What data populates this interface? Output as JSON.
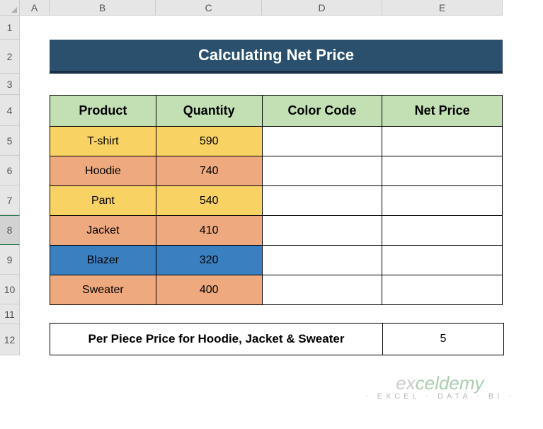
{
  "columns": [
    "A",
    "B",
    "C",
    "D",
    "E"
  ],
  "rows": [
    "1",
    "2",
    "3",
    "4",
    "5",
    "6",
    "7",
    "8",
    "9",
    "10",
    "11",
    "12"
  ],
  "title": "Calculating Net Price",
  "headers": {
    "product": "Product",
    "quantity": "Quantity",
    "color_code": "Color Code",
    "net_price": "Net Price"
  },
  "data": [
    {
      "product": "T-shirt",
      "quantity": "590",
      "color": "yellow"
    },
    {
      "product": "Hoodie",
      "quantity": "740",
      "color": "orange"
    },
    {
      "product": "Pant",
      "quantity": "540",
      "color": "yellow"
    },
    {
      "product": "Jacket",
      "quantity": "410",
      "color": "orange"
    },
    {
      "product": "Blazer",
      "quantity": "320",
      "color": "blue"
    },
    {
      "product": "Sweater",
      "quantity": "400",
      "color": "orange"
    }
  ],
  "footer": {
    "label": "Per Piece Price for Hoodie, Jacket & Sweater",
    "value": "5"
  },
  "selected_row": "8",
  "watermark": {
    "main_1": "ex",
    "main_2": "celdemy",
    "sub": "· EXCEL · DATA · BI ·"
  }
}
